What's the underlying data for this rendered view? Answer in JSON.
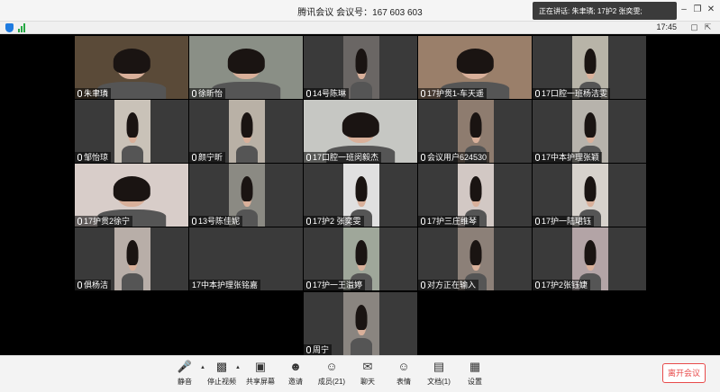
{
  "window": {
    "title": "腾讯会议 会议号：167 603 603",
    "speaking": "正在讲话: 朱聿璘; 17护2 张奕雯;",
    "clock": "17:45"
  },
  "participants": [
    {
      "name": "朱聿璘",
      "mic": true,
      "bg": "#5a4a38"
    },
    {
      "name": "徐昕怡",
      "mic": true,
      "bg": "#8a8f86"
    },
    {
      "name": "14号陈琳",
      "mic": true,
      "bg": "#6a6664"
    },
    {
      "name": "17护贯1-车天遥",
      "mic": true,
      "bg": "#9a7f6a"
    },
    {
      "name": "17口腔一班杨洁雯",
      "mic": true,
      "bg": "#b8b4a8"
    },
    {
      "name": "邹怡琼",
      "mic": true,
      "bg": "#c9c2b8"
    },
    {
      "name": "颜宁昕",
      "mic": true,
      "bg": "#b9b1a6"
    },
    {
      "name": "17口腔一班闵毅杰",
      "mic": true,
      "bg": "#c6c7c3"
    },
    {
      "name": "会议用户624530",
      "mic": true,
      "bg": "#8e7c6f"
    },
    {
      "name": "17中本护理张颖",
      "mic": true,
      "bg": "#b7b3ac"
    },
    {
      "name": "17护贯2徐宁",
      "mic": true,
      "bg": "#d8cdc9"
    },
    {
      "name": "13号陈佳妮",
      "mic": true,
      "bg": "#8b8a83"
    },
    {
      "name": "17护2 张奕雯",
      "mic": true,
      "bg": "#e0e0e0"
    },
    {
      "name": "17护三庄维琴",
      "mic": true,
      "bg": "#d2c8c4"
    },
    {
      "name": "17护一陆珺钰",
      "mic": true,
      "bg": "#d7d2cc"
    },
    {
      "name": "俱杨洁",
      "mic": true,
      "bg": "#b8aea8"
    },
    {
      "name": "17中本护理张铭嘉",
      "mic": false,
      "bg": "#3a3a3a"
    },
    {
      "name": "17护一王溢婷",
      "mic": true,
      "bg": "#9fa79a"
    },
    {
      "name": "对方正在输入",
      "mic": true,
      "bg": "#8c8078"
    },
    {
      "name": "17护2张钰婕",
      "mic": true,
      "bg": "#b3a4a6"
    },
    {
      "name": "周宁",
      "mic": true,
      "bg": "#8a8580"
    }
  ],
  "toolbar": {
    "mute": "静音",
    "video": "停止视频",
    "share": "共享屏幕",
    "invite": "邀请",
    "members": "成员(21)",
    "chat": "聊天",
    "reactions": "表情",
    "docs": "文档(1)",
    "settings": "设置",
    "leave": "离开会议"
  },
  "icons": {
    "mute": "microphone-icon",
    "video": "video-camera-icon",
    "share": "screen-share-icon",
    "invite": "add-person-icon",
    "members": "people-icon",
    "chat": "chat-icon",
    "reactions": "smiley-icon",
    "docs": "document-icon",
    "settings": "grid-icon"
  },
  "colors": {
    "accent": "#1e7be0",
    "leave": "#e84a4a",
    "signal": "#27a844"
  }
}
